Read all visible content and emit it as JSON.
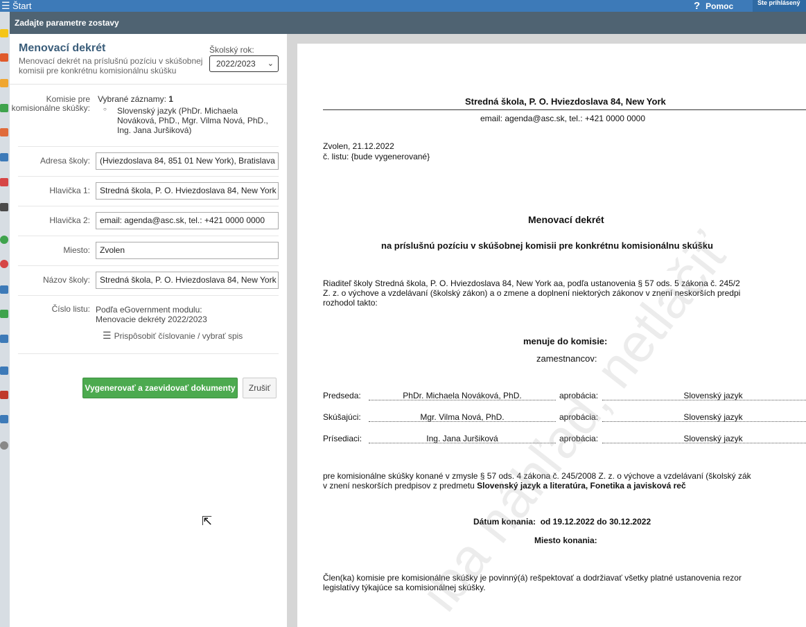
{
  "topbar": {
    "start_label": "Štart",
    "help_label": "Pomoc",
    "login_label": "Ste prihlásený"
  },
  "dialog": {
    "title": "Zadajte parametre zostavy"
  },
  "form": {
    "title": "Menovací dekrét",
    "subtitle": "Menovací dekrét na príslušnú pozíciu v skúšobnej komisii pre konkrétnu komisionálnu skúšku",
    "year_label": "Školský rok:",
    "year_value": "2022/2023",
    "commission_label": "Komisie pre komisionálne skúšky:",
    "selected_prefix": "Vybrané záznamy:",
    "selected_count": "1",
    "selected_item": "Slovenský jazyk (PhDr. Michaela Nováková, PhD., Mgr. Vilma Nová, PhD., Ing. Jana Juršiková)",
    "address_label": "Adresa školy:",
    "address_value": "(Hviezdoslava 84, 851 01 New York), Bratislava",
    "header1_label": "Hlavička 1:",
    "header1_value": "Stredná škola, P. O. Hviezdoslava 84, New York",
    "header2_label": "Hlavička 2:",
    "header2_value": "email: agenda@asc.sk, tel.: +421 0000 0000",
    "place_label": "Miesto:",
    "place_value": "Zvolen",
    "school_label": "Názov školy:",
    "school_value": "Stredná škola, P. O. Hviezdoslava 84, New York",
    "number_label": "Číslo listu:",
    "number_info_1": "Podľa eGovernment modulu:",
    "number_info_2": "Menovacie dekréty 2022/2023",
    "customize_label": "Prispôsobiť číslovanie / vybrať spis",
    "generate_button": "Vygenerovať a zaevidovať dokumenty",
    "cancel_button": "Zrušiť"
  },
  "preview": {
    "school_header": "Stredná škola, P. O. Hviezdoslava 84, New York",
    "contact_header": "email: agenda@asc.sk, tel.: +421 0000 0000",
    "place_date": "Zvolen, 21.12.2022",
    "letter_number": "č. listu: {bude vygenerované}",
    "title": "Menovací dekrét",
    "subtitle": "na príslušnú pozíciu v skúšobnej komisii pre konkrétnu komisionálnu skúšku",
    "intro_1": "Riaditeľ školy Stredná škola, P. O. Hviezdoslava 84, New York aa, podľa ustanovenia § 57 ods. 5 zákona č. 245/2",
    "intro_2": "Z. z. o výchove a vzdelávaní (školský zákon) a o zmene a doplnení niektorých zákonov v znení neskorších predpi",
    "intro_3": "rozhodol takto:",
    "appoints": "menuje do komisie:",
    "employees": "zamestnancov:",
    "members": [
      {
        "role": "Predseda:",
        "name": "PhDr. Michaela Nováková, PhD.",
        "approb_label": "aprobácia:",
        "approb": "Slovenský jazyk"
      },
      {
        "role": "Skúšajúci:",
        "name": "Mgr. Vilma Nová, PhD.",
        "approb_label": "aprobácia:",
        "approb": "Slovenský jazyk"
      },
      {
        "role": "Prísediaci:",
        "name": "Ing. Jana Juršiková",
        "approb_label": "aprobácia:",
        "approb": "Slovenský jazyk"
      }
    ],
    "exam_1": "pre komisionálne skúšky konané v zmysle § 57 ods. 4 zákona č. 245/2008 Z. z. o výchove a vzdelávaní (školský zák",
    "exam_2_prefix": "v znení neskorších predpisov z predmetu ",
    "exam_2_subject": "Slovenský jazyk a literatúra, Fonetika a javisková reč",
    "date_label": "Dátum konania:",
    "date_value": "od 19.12.2022 do 30.12.2022",
    "place_label": "Miesto konania:",
    "duty_1": "Člen(ka) komisie pre komisionálne skúšky je povinný(á) rešpektovať a dodržiavať všetky platné ustanovenia rezor",
    "duty_2": "legislatívy týkajúce sa komisionálnej skúšky.",
    "watermark": "iba náhľad, netlačiť"
  },
  "icons": {
    "menu": "hamburger-icon",
    "help": "question-icon",
    "customize": "sliders-icon",
    "dropdown": "chevron-down-icon",
    "cursor": "mouse-pointer-icon"
  }
}
